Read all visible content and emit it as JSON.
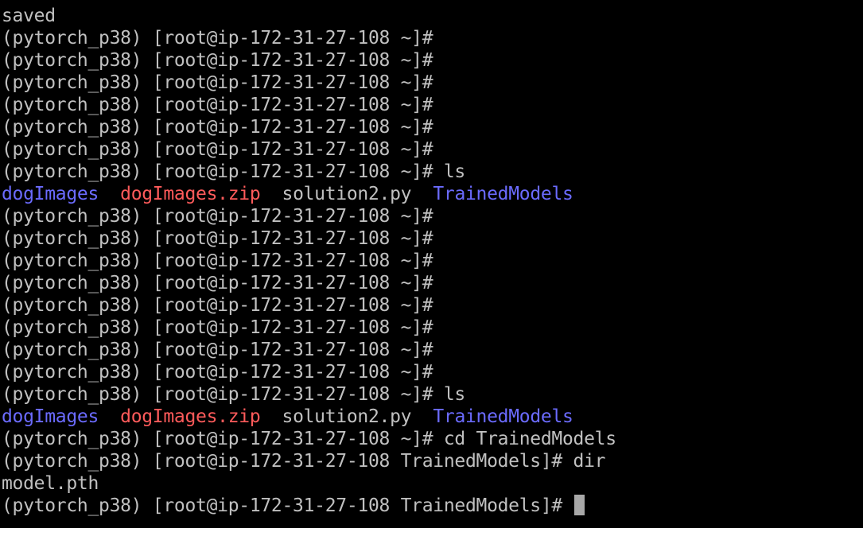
{
  "colors": {
    "background": "#000000",
    "foreground": "#c0c0c0",
    "directory": "#6b6bff",
    "archive": "#ff5b5b",
    "cursor": "#a8a8a8"
  },
  "terminal": {
    "lines": [
      {
        "segments": [
          {
            "text": "saved",
            "kind": "default"
          }
        ]
      },
      {
        "segments": [
          {
            "text": "(pytorch_p38) [root@ip-172-31-27-108 ~]#",
            "kind": "default"
          }
        ]
      },
      {
        "segments": [
          {
            "text": "(pytorch_p38) [root@ip-172-31-27-108 ~]#",
            "kind": "default"
          }
        ]
      },
      {
        "segments": [
          {
            "text": "(pytorch_p38) [root@ip-172-31-27-108 ~]#",
            "kind": "default"
          }
        ]
      },
      {
        "segments": [
          {
            "text": "(pytorch_p38) [root@ip-172-31-27-108 ~]#",
            "kind": "default"
          }
        ]
      },
      {
        "segments": [
          {
            "text": "(pytorch_p38) [root@ip-172-31-27-108 ~]#",
            "kind": "default"
          }
        ]
      },
      {
        "segments": [
          {
            "text": "(pytorch_p38) [root@ip-172-31-27-108 ~]#",
            "kind": "default"
          }
        ]
      },
      {
        "segments": [
          {
            "text": "(pytorch_p38) [root@ip-172-31-27-108 ~]# ls",
            "kind": "default"
          }
        ]
      },
      {
        "segments": [
          {
            "text": "dogImages",
            "kind": "dir"
          },
          {
            "text": "  ",
            "kind": "default"
          },
          {
            "text": "dogImages.zip",
            "kind": "archive"
          },
          {
            "text": "  ",
            "kind": "default"
          },
          {
            "text": "solution2.py",
            "kind": "file"
          },
          {
            "text": "  ",
            "kind": "default"
          },
          {
            "text": "TrainedModels",
            "kind": "dir"
          }
        ]
      },
      {
        "segments": [
          {
            "text": "(pytorch_p38) [root@ip-172-31-27-108 ~]#",
            "kind": "default"
          }
        ]
      },
      {
        "segments": [
          {
            "text": "(pytorch_p38) [root@ip-172-31-27-108 ~]#",
            "kind": "default"
          }
        ]
      },
      {
        "segments": [
          {
            "text": "(pytorch_p38) [root@ip-172-31-27-108 ~]#",
            "kind": "default"
          }
        ]
      },
      {
        "segments": [
          {
            "text": "(pytorch_p38) [root@ip-172-31-27-108 ~]#",
            "kind": "default"
          }
        ]
      },
      {
        "segments": [
          {
            "text": "(pytorch_p38) [root@ip-172-31-27-108 ~]#",
            "kind": "default"
          }
        ]
      },
      {
        "segments": [
          {
            "text": "(pytorch_p38) [root@ip-172-31-27-108 ~]#",
            "kind": "default"
          }
        ]
      },
      {
        "segments": [
          {
            "text": "(pytorch_p38) [root@ip-172-31-27-108 ~]#",
            "kind": "default"
          }
        ]
      },
      {
        "segments": [
          {
            "text": "(pytorch_p38) [root@ip-172-31-27-108 ~]#",
            "kind": "default"
          }
        ]
      },
      {
        "segments": [
          {
            "text": "(pytorch_p38) [root@ip-172-31-27-108 ~]# ls",
            "kind": "default"
          }
        ]
      },
      {
        "segments": [
          {
            "text": "dogImages",
            "kind": "dir"
          },
          {
            "text": "  ",
            "kind": "default"
          },
          {
            "text": "dogImages.zip",
            "kind": "archive"
          },
          {
            "text": "  ",
            "kind": "default"
          },
          {
            "text": "solution2.py",
            "kind": "file"
          },
          {
            "text": "  ",
            "kind": "default"
          },
          {
            "text": "TrainedModels",
            "kind": "dir"
          }
        ]
      },
      {
        "segments": [
          {
            "text": "(pytorch_p38) [root@ip-172-31-27-108 ~]# cd TrainedModels",
            "kind": "default"
          }
        ]
      },
      {
        "segments": [
          {
            "text": "(pytorch_p38) [root@ip-172-31-27-108 TrainedModels]# dir",
            "kind": "default"
          }
        ]
      },
      {
        "segments": [
          {
            "text": "model.pth",
            "kind": "file"
          }
        ]
      },
      {
        "segments": [
          {
            "text": "(pytorch_p38) [root@ip-172-31-27-108 TrainedModels]# ",
            "kind": "default"
          }
        ],
        "cursor": true
      }
    ]
  }
}
